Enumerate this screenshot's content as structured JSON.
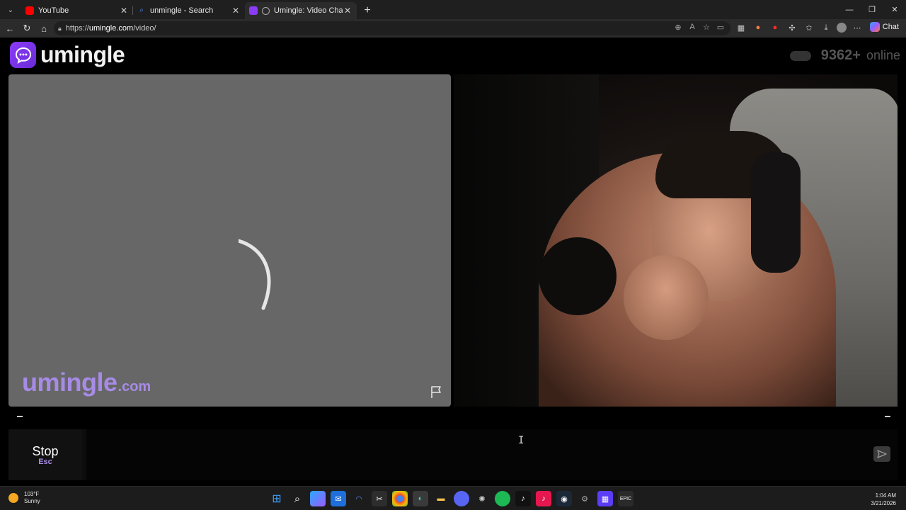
{
  "browser": {
    "tabs": [
      {
        "title": "YouTube",
        "favicon_color": "#ff0000",
        "active": false
      },
      {
        "title": "unmingle - Search",
        "favicon_color": "#4a8cff",
        "active": false
      },
      {
        "title": "Umingle: Video Chat with Stra",
        "favicon_color": "#8b3cf7",
        "active": true
      }
    ],
    "url_prefix": "https://",
    "url_host": "umingle.com",
    "url_path": "/video/",
    "copilot_label": "Chat"
  },
  "site": {
    "logo_text": "umingle",
    "online_count": "9362+",
    "online_label": "online",
    "watermark_main": "umingle",
    "watermark_suffix": ".com",
    "stop_label": "Stop",
    "stop_shortcut": "Esc",
    "chat_placeholder": "",
    "accent_color": "#8b3cf7"
  },
  "taskbar": {
    "weather_temp": "103°F",
    "weather_desc": "Sunny",
    "time": "1:04 AM",
    "date": "3/21/2026"
  }
}
